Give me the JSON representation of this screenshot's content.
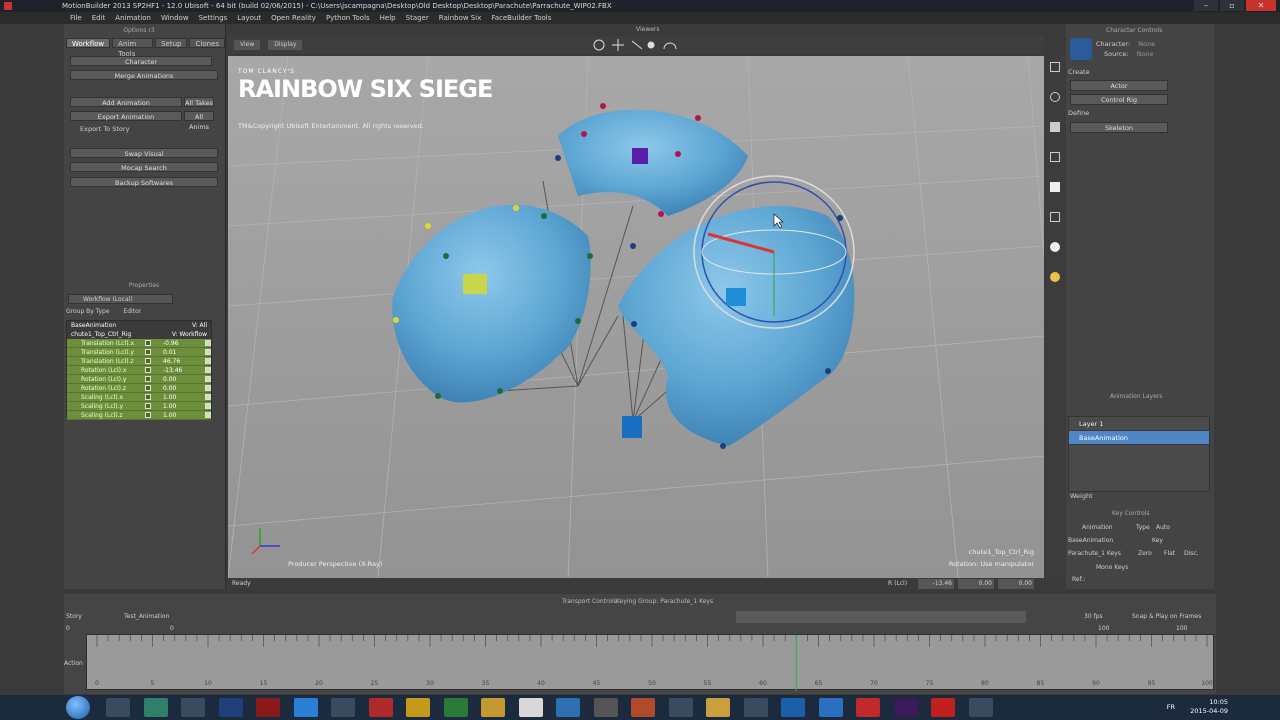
{
  "window": {
    "title": "MotionBuilder 2013 SP2HF1 - 12.0 Ubisoft - 64 bit (build 02/06/2015) - C:\\Users\\jscampagna\\Desktop\\Old Desktop\\Desktop\\Parachute\\Parrachute_WIP02.FBX"
  },
  "menu": [
    "File",
    "Edit",
    "Animation",
    "Window",
    "Settings",
    "Layout",
    "Open Reality",
    "Python Tools",
    "Help",
    "Stager",
    "Rainbow Six",
    "FaceBuilder Tools"
  ],
  "left_panel": {
    "top_title": "Options r3",
    "tabs": [
      "Workflow",
      "Anim Tools",
      "Setup",
      "Clones"
    ],
    "buttons": [
      "Character",
      "Merge Animations",
      "Add Animation",
      "All Takes",
      "Export Animation",
      "All Anims",
      "Export To Story",
      "Swap Visual",
      "Mocap Search",
      "Backup Softwares"
    ],
    "properties": {
      "title": "Properties",
      "selector": "Workflow (Local)",
      "group_label": "Group By Type",
      "editor_label": "Editor",
      "base_animation": "BaseAnimation",
      "base_animation_right": "V: All",
      "object": "chute1_Top_Ctrl_Rig",
      "object_right": "V: Workflow",
      "rows": [
        {
          "name": "Translation (Lcl).x",
          "value": "-0.96"
        },
        {
          "name": "Translation (Lcl).y",
          "value": "0.01"
        },
        {
          "name": "Translation (Lcl).z",
          "value": "46.76"
        },
        {
          "name": "Rotation (Lcl).x",
          "value": "-13.46"
        },
        {
          "name": "Rotation (Lcl).y",
          "value": "0.00"
        },
        {
          "name": "Rotation (Lcl).z",
          "value": "0.00"
        },
        {
          "name": "Scaling (Lcl).x",
          "value": "1.00"
        },
        {
          "name": "Scaling (Lcl).y",
          "value": "1.00"
        },
        {
          "name": "Scaling (Lcl).z",
          "value": "1.00"
        }
      ]
    }
  },
  "viewer": {
    "header": "Viewers",
    "menu": [
      "View",
      "Display"
    ],
    "logo_prefix": "TOM CLANCY'S",
    "logo": "RAINBOW SIX SIEGE",
    "copyright": "TM&Copyright Ubisoft Entertainment. All rights reserved.",
    "camera": "Producer Perspective (X-Ray)",
    "selection": "chute1_Top_Ctrl_Rig",
    "rotation_mode": "Rotation: Use manipulator",
    "status": "Ready",
    "coords_label": "R (Lcl)",
    "coords": [
      "-13.46",
      "0.00",
      "0.00"
    ]
  },
  "right_panel": {
    "title": "Character Controls",
    "character_label": "Character:",
    "character_value": "None",
    "source_label": "Source:",
    "source_value": "None",
    "create_label": "Create",
    "buttons": [
      "Actor",
      "Control Rig",
      "Skeleton"
    ],
    "define_label": "Define",
    "anim_layers": {
      "title": "Animation Layers",
      "layers": [
        "Layer 1",
        "BaseAnimation"
      ],
      "weight_label": "Weight"
    },
    "key_controls": {
      "title": "Key Controls",
      "animation_label": "Animation",
      "type_label": "Type",
      "type_value": "Auto",
      "base": "BaseAnimation",
      "key_label": "Key",
      "keying_group": "Parachute_1 Keys",
      "zero": "Zero",
      "flat": "Flat",
      "disc": "Disc.",
      "mono_keys": "Mono Keys",
      "ref_label": "Ref.:"
    }
  },
  "transport": {
    "story_label": "Story",
    "take_name": "Test_Animation",
    "title": "Transport Controls",
    "keying_group": "Keying Group: Parachute_1 Keys",
    "fps": "30 fps",
    "snap": "Snap & Play on Frames",
    "start": "0",
    "current": "0",
    "end": "100",
    "end2": "100",
    "action_label": "Action",
    "ruler": [
      "0",
      "5",
      "10",
      "15",
      "20",
      "25",
      "30",
      "35",
      "40",
      "45",
      "50",
      "55",
      "60",
      "65",
      "70",
      "75",
      "80",
      "85",
      "90",
      "95",
      "100"
    ]
  },
  "taskbar": {
    "lang": "FR",
    "time": "10:05",
    "date": "2015-04-09"
  },
  "colors": {
    "accent": "#4f86c6",
    "canopy": "#6fb2dc",
    "prop_green": "#6d8f3c"
  }
}
